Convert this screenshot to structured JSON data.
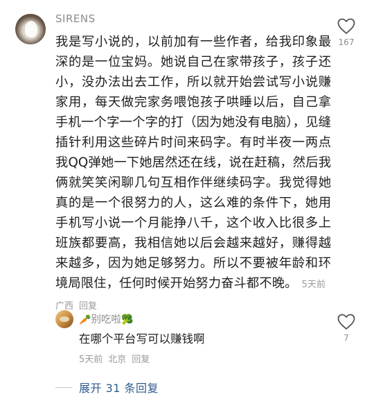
{
  "comment": {
    "username": "SIRENS",
    "text": "我是写小说的，以前加有一些作者，给我印象最深的是一位宝妈。她说自己在家带孩子，孩子还小，没办法出去工作，所以就开始尝试写小说赚家用，每天做完家务喂饱孩子哄睡以后，自己拿手机一个字一个字的打（因为她没有电脑），见缝插针利用这些碎片时间来码字。有时半夜一两点我QQ弹她一下她居然还在线，说在赶稿，然后我俩就笑笑闲聊几句互相作伴继续码字。我觉得她真的是一个很努力的人，这么难的条件下，她用手机写小说一个月能挣八千，这个收入比很多上班族都要高，我相信她以后会越来越好，赚得越来越多，因为她足够努力。所以不要被年龄和环境局限住，任何时候开始努力奋斗都不晚。",
    "time": "5天前",
    "location": "广西",
    "reply_label": "回复",
    "like_count": "167"
  },
  "reply": {
    "username_prefix_emoji": "🥕",
    "username": "别吃啦",
    "username_suffix_emoji": "🥦",
    "text": "在哪个平台写可以赚钱啊",
    "time": "5天前",
    "location": "北京",
    "reply_label": "回复",
    "like_count": "7"
  },
  "expand": {
    "label": "展开 31 条回复"
  },
  "colors": {
    "link": "#2e5b8c",
    "meta": "#9a9a9a",
    "text": "#1f1f1f"
  }
}
